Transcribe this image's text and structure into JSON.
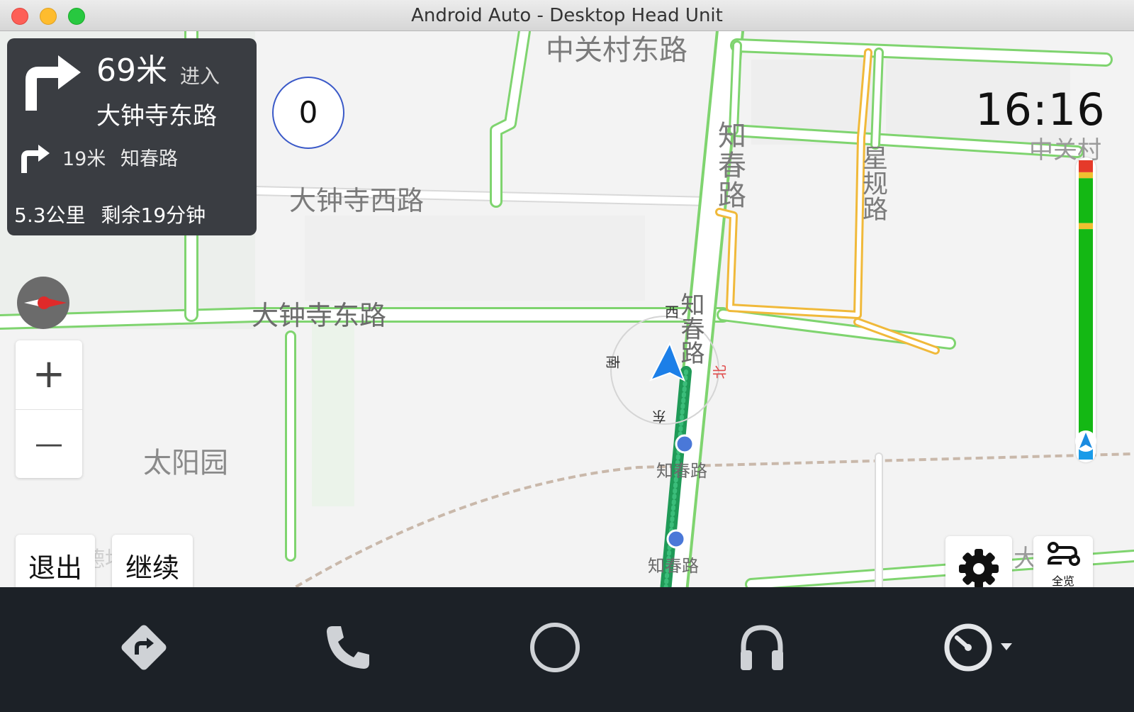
{
  "window": {
    "title": "Android Auto - Desktop Head Unit"
  },
  "map": {
    "labels": {
      "road_top": "中关村东路",
      "road_zhichun_vertical": "知春路",
      "road_xingui": "星规路",
      "road_dazhongsi_west": "大钟寺西路",
      "road_dazhongsi_east": "大钟寺东路",
      "area_taiyangyuan": "太阳园",
      "road_zhichun_center": "知春路",
      "stop_1": "知春路",
      "stop_2": "知春路",
      "right_fragment": "中关村",
      "bottom_right_fragment": "大",
      "watermark": "高德地图"
    },
    "compass_labels": {
      "west": "西",
      "south": "南",
      "north": "北",
      "east": "东"
    }
  },
  "navigation": {
    "distance": "69米",
    "action": "进入",
    "road": "大钟寺东路",
    "next": {
      "distance": "19米",
      "road": "知春路"
    },
    "remaining_distance": "5.3公里",
    "remaining_time": "剩余19分钟"
  },
  "speed": "0",
  "clock": "16:16",
  "buttons": {
    "zoom_in": "+",
    "zoom_out": "—",
    "exit": "退出",
    "continue": "继续",
    "overview": "全览"
  },
  "colors": {
    "road_outline": "#7fd46f",
    "route": "#1f9a57",
    "traffic_green": "#14b814",
    "traffic_yellow": "#f0c030",
    "traffic_red": "#e53a2a",
    "traffic_blue": "#1a9be8",
    "nav_card_bg": "#3a3d42",
    "dock_bg": "#1c2127"
  },
  "traffic_bar_segments": [
    {
      "color": "red",
      "fraction": 0.04
    },
    {
      "color": "yellow",
      "fraction": 0.02
    },
    {
      "color": "green",
      "fraction": 0.15
    },
    {
      "color": "yellow",
      "fraction": 0.02
    },
    {
      "color": "green",
      "fraction": 0.72
    },
    {
      "color": "blue",
      "fraction": 0.05
    }
  ],
  "dock": {
    "items": [
      {
        "name": "navigation-icon"
      },
      {
        "name": "phone-icon"
      },
      {
        "name": "home-icon"
      },
      {
        "name": "headphones-icon"
      },
      {
        "name": "dashboard-icon"
      }
    ]
  }
}
